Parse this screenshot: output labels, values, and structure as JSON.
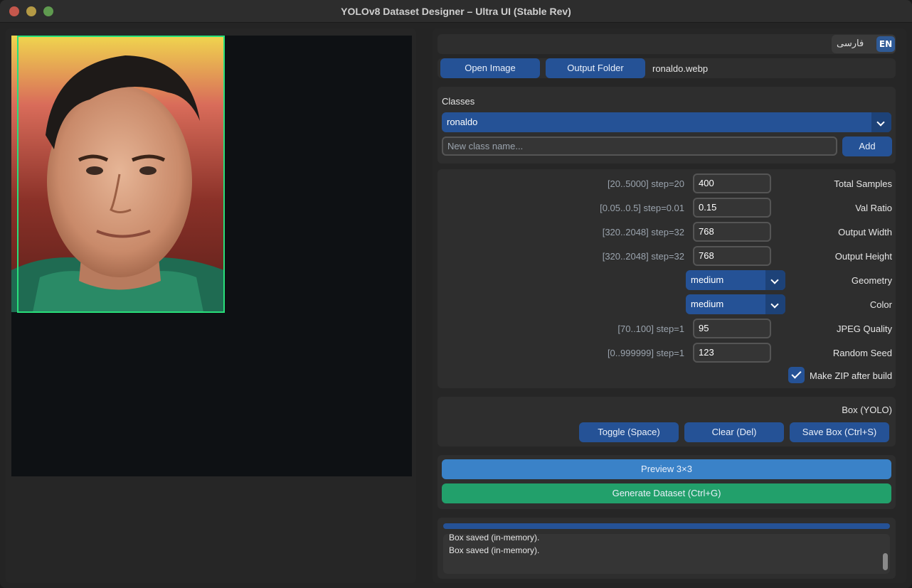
{
  "window": {
    "title": "YOLOv8 Dataset Designer – Ultra UI (Stable Rev)"
  },
  "lang": {
    "fa": "فارسی",
    "en": "EN"
  },
  "file": {
    "open_label": "Open Image",
    "output_label": "Output Folder",
    "filename": "ronaldo.webp"
  },
  "classes": {
    "heading": "Classes",
    "selected": "ronaldo",
    "new_placeholder": "New class name...",
    "add_label": "Add"
  },
  "params": [
    {
      "hint": "[20..5000] step=20",
      "value": "400",
      "label": "Total Samples"
    },
    {
      "hint": "[0.05..0.5] step=0.01",
      "value": "0.15",
      "label": "Val Ratio"
    },
    {
      "hint": "[320..2048] step=32",
      "value": "768",
      "label": "Output Width"
    },
    {
      "hint": "[320..2048] step=32",
      "value": "768",
      "label": "Output Height"
    },
    {
      "hint": "",
      "value": "medium",
      "label": "Geometry"
    },
    {
      "hint": "",
      "value": "medium",
      "label": "Color"
    },
    {
      "hint": "[70..100] step=1",
      "value": "95",
      "label": "JPEG Quality"
    },
    {
      "hint": "[0..999999] step=1",
      "value": "123",
      "label": "Random Seed"
    }
  ],
  "zip": {
    "label": "Make ZIP after build",
    "checked": true
  },
  "box": {
    "heading": "Box (YOLO)",
    "toggle_label": "Toggle (Space)",
    "clear_label": "Clear (Del)",
    "save_label": "Save Box (Ctrl+S)"
  },
  "actions": {
    "preview_label": "Preview 3×3",
    "generate_label": "Generate Dataset (Ctrl+G)"
  },
  "log": {
    "lines": [
      "Box saved (in-memory).",
      "Box saved (in-memory)."
    ]
  },
  "colors": {
    "accent": "#255296",
    "preview": "#3a82c8",
    "generate": "#22a06b",
    "bbox": "#28e07a"
  }
}
